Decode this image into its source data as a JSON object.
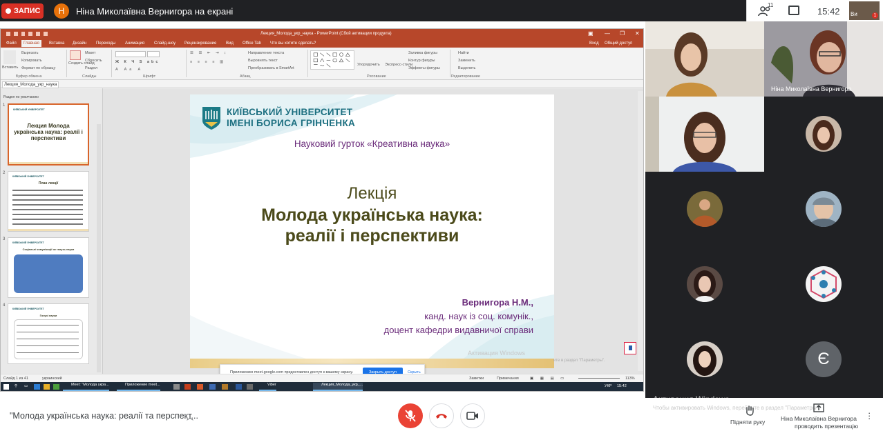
{
  "meet": {
    "record_label": "ЗАПИС",
    "presenter_initial": "Н",
    "presenter_banner": "Ніна Миколаївна Вернигора на екрані",
    "participants_count": "11",
    "time": "15:42",
    "self_label": "Ви",
    "self_badge": "1",
    "meeting_title": "\"Молода українська наука: реалії та перспект...",
    "raise_hand_label": "Підняти руку",
    "presenting_name": "Ніна Миколаївна Вернигора",
    "presenting_label": "проводить презентацію",
    "win_activation_title": "Активация Windows",
    "win_activation_text": "Чтобы активировать Windows, перейдите в раздел \"Параметры\"."
  },
  "participants": {
    "tile_names": [
      "Ніна Миколаївна Вернигора"
    ],
    "letter_avatar": "Є"
  },
  "ppt": {
    "window_title": "Лекция_Молода_укр_наука - PowerPoint (Сбой активации продукта)",
    "tabs": [
      "Файл",
      "Главная",
      "Вставка",
      "Дизайн",
      "Переходы",
      "Анимация",
      "Слайд-шоу",
      "Рецензирование",
      "Вид",
      "Office Tab",
      "Что вы хотите сделать?",
      "Вход",
      "Общий доступ"
    ],
    "ribbon": {
      "clipboard": [
        "Вставить",
        "Вырезать",
        "Копировать",
        "Формат по образцу"
      ],
      "clipboard_label": "Буфер обмена",
      "slides": [
        "Создать слайд",
        "Макет",
        "Сбросить",
        "Раздел"
      ],
      "slides_label": "Слайды",
      "font_label": "Шрифт",
      "paragraph": [
        "Направление текста",
        "Выровнять текст",
        "Преобразовать в SmartArt"
      ],
      "paragraph_label": "Абзац",
      "drawing": [
        "Упорядочить",
        "Экспресс-стили",
        "Заливка фигуры",
        "Контур фигуры",
        "Эффекты фигуры"
      ],
      "drawing_label": "Рисование",
      "editing": [
        "Найти",
        "Заменить",
        "Выделить"
      ],
      "editing_label": "Редактирование"
    },
    "doc_tab": "Лекция_Молода_укр_наука",
    "section_label": "Раздел по умолчанию",
    "thumb_numbers": [
      "1",
      "2",
      "3",
      "4"
    ],
    "thumb_title": "Лекция Молода українська наука: реалії і перспективи",
    "thumb2_title": "План лекції",
    "thumb3_title": "Соціальні комунікації як галузь науки",
    "thumb4_title": "Галузі науки",
    "slide": {
      "uni_line1": "КИЇВСЬКИЙ УНІВЕРСИТЕТ",
      "uni_line2": "ІМЕНІ БОРИСА ГРІНЧЕНКА",
      "circle": "Науковий гурток «Креативна наука»",
      "lecture": "Лекція",
      "title_line1": "Молода українська наука:",
      "title_line2": "реалії і перспективи",
      "author_name": "Вернигора Н.М.,",
      "author_degree": "канд. наук із соц. комунік.,",
      "author_position": "доцент кафедри видавничої справи",
      "watermark": "Активация Windows"
    },
    "share_notice": {
      "text": "Приложению meet.google.com предоставлен доступ к вашему экрану.",
      "stop": "Закрыть доступ",
      "hide": "Скрыть"
    },
    "status": {
      "slide_of": "Слайд 1 из 41",
      "language": "украинский",
      "notes": "Заметки",
      "comments": "Примечания",
      "zoom": "113%",
      "stage_hint": "ите в раздел \"Параметры\"."
    },
    "taskbar": {
      "apps": [
        "Meet: \"Молода укра...",
        "Приложение meet...",
        "Viber",
        "Лекция_Молода_укр_..."
      ],
      "lang": "УКР",
      "time": "15:42"
    }
  }
}
